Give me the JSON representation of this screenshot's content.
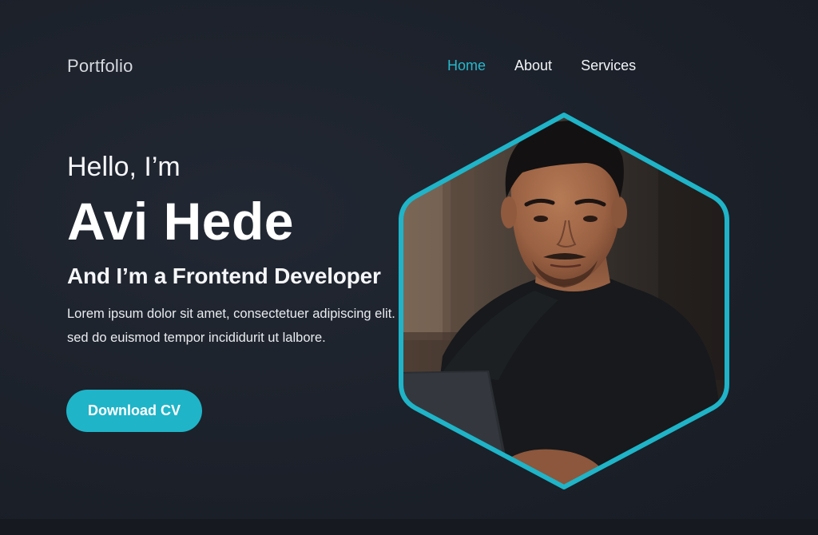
{
  "header": {
    "logo": "Portfolio",
    "nav": [
      {
        "label": "Home",
        "active": true
      },
      {
        "label": "About",
        "active": false
      },
      {
        "label": "Services",
        "active": false
      }
    ]
  },
  "hero": {
    "greeting": "Hello, I’m",
    "name": "Avi Hede",
    "role": "And I’m a Frontend Developer",
    "bio": "Lorem ipsum dolor sit amet, consectetuer adipiscing elit. sed do euismod tempor incididurit ut lalbore.",
    "cta_label": "Download CV"
  },
  "colors": {
    "accent": "#1fb4c8",
    "background": "#1c212a"
  },
  "portrait": {
    "shape": "hexagon",
    "subject": "person-photo"
  }
}
